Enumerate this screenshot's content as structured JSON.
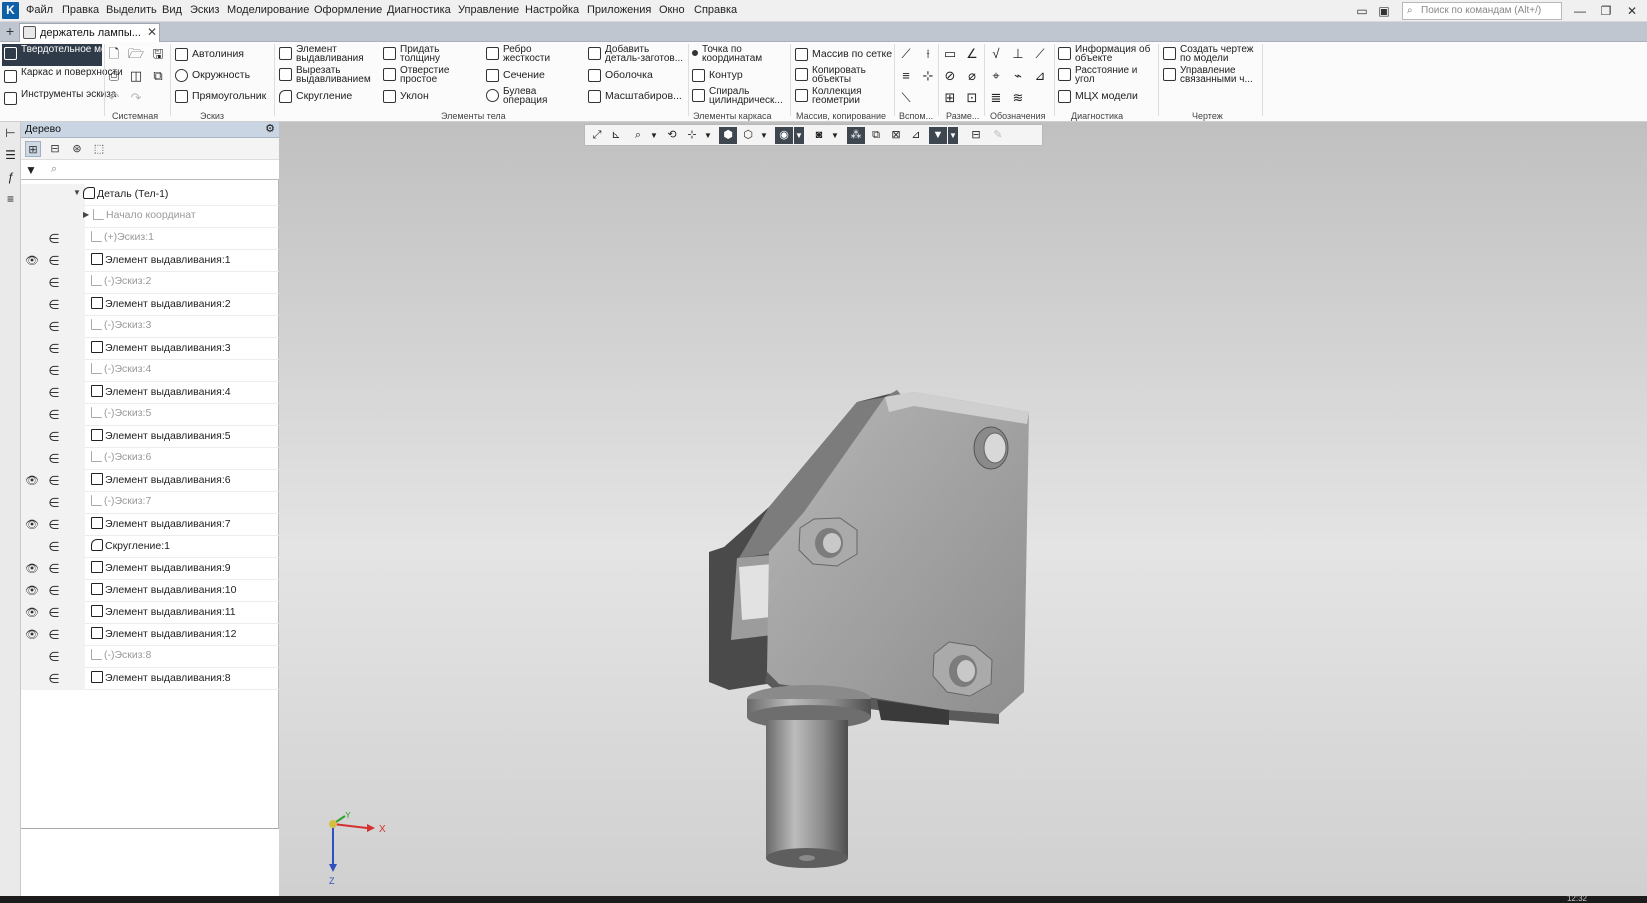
{
  "menubar": {
    "items": [
      "Файл",
      "Правка",
      "Выделить",
      "Вид",
      "Эскиз",
      "Моделирование",
      "Оформление",
      "Диагностика",
      "Управление",
      "Настройка",
      "Приложения",
      "Окно",
      "Справка"
    ],
    "search_placeholder": "Поиск по командам (Alt+/)"
  },
  "tabs": {
    "document": "держатель лампы..."
  },
  "ribbon": {
    "modes": [
      "Твердотельное моделирование",
      "Каркас и поверхности",
      "Инструменты эскиза"
    ],
    "sketch": [
      "Автолиния",
      "Окружность",
      "Прямоугольник"
    ],
    "body1": [
      "Элемент выдавливания",
      "Вырезать выдавливанием",
      "Скругление"
    ],
    "body2": [
      "Придать толщину",
      "Отверстие простое",
      "Уклон"
    ],
    "body3": [
      "Ребро жесткости",
      "Сечение",
      "Булева операция"
    ],
    "body4": [
      "Добавить деталь-заготов...",
      "Оболочка",
      "Масштабиров..."
    ],
    "frame": [
      "Точка по координатам",
      "Контур",
      "Спираль цилиндрическ..."
    ],
    "array": [
      "Массив по сетке",
      "Копировать объекты",
      "Коллекция геометрии"
    ],
    "diag": [
      "Информация об объекте",
      "Расстояние и угол",
      "МЦХ модели"
    ],
    "drawing": [
      "Создать чертеж по модели",
      "Управление связанными ч..."
    ],
    "group_titles": [
      "Системная",
      "Эскиз",
      "Элементы тела",
      "Элементы каркаса",
      "Массив, копирование",
      "Вспом...",
      "Разме...",
      "Обозначения",
      "Диагностика",
      "Чертеж"
    ]
  },
  "tree": {
    "title": "Дерево",
    "rows": [
      {
        "label": "Деталь (Тел-1)",
        "eye": false,
        "inc": false,
        "kind": "root"
      },
      {
        "label": "Начало координат",
        "eye": false,
        "inc": false,
        "kind": "origin"
      },
      {
        "label": "(+)Эскиз:1",
        "eye": false,
        "inc": true,
        "kind": "sketch"
      },
      {
        "label": "Элемент выдавливания:1",
        "eye": true,
        "inc": true,
        "kind": "feature"
      },
      {
        "label": "(-)Эскиз:2",
        "eye": false,
        "inc": true,
        "kind": "sketch"
      },
      {
        "label": "Элемент выдавливания:2",
        "eye": false,
        "inc": true,
        "kind": "feature"
      },
      {
        "label": "(-)Эскиз:3",
        "eye": false,
        "inc": true,
        "kind": "sketch"
      },
      {
        "label": "Элемент выдавливания:3",
        "eye": false,
        "inc": true,
        "kind": "feature"
      },
      {
        "label": "(-)Эскиз:4",
        "eye": false,
        "inc": true,
        "kind": "sketch"
      },
      {
        "label": "Элемент выдавливания:4",
        "eye": false,
        "inc": true,
        "kind": "feature"
      },
      {
        "label": "(-)Эскиз:5",
        "eye": false,
        "inc": true,
        "kind": "sketch"
      },
      {
        "label": "Элемент выдавливания:5",
        "eye": false,
        "inc": true,
        "kind": "feature"
      },
      {
        "label": "(-)Эскиз:6",
        "eye": false,
        "inc": true,
        "kind": "sketch"
      },
      {
        "label": "Элемент выдавливания:6",
        "eye": true,
        "inc": true,
        "kind": "feature"
      },
      {
        "label": "(-)Эскиз:7",
        "eye": false,
        "inc": true,
        "kind": "sketch"
      },
      {
        "label": "Элемент выдавливания:7",
        "eye": true,
        "inc": true,
        "kind": "feature"
      },
      {
        "label": "Скругление:1",
        "eye": false,
        "inc": true,
        "kind": "fillet"
      },
      {
        "label": "Элемент выдавливания:9",
        "eye": true,
        "inc": true,
        "kind": "feature"
      },
      {
        "label": "Элемент выдавливания:10",
        "eye": true,
        "inc": true,
        "kind": "feature"
      },
      {
        "label": "Элемент выдавливания:11",
        "eye": true,
        "inc": true,
        "kind": "feature"
      },
      {
        "label": "Элемент выдавливания:12",
        "eye": true,
        "inc": true,
        "kind": "feature"
      },
      {
        "label": "(-)Эскиз:8",
        "eye": false,
        "inc": true,
        "kind": "sketch"
      },
      {
        "label": "Элемент выдавливания:8",
        "eye": false,
        "inc": true,
        "kind": "feature"
      }
    ]
  },
  "axes": {
    "x": "X",
    "y": "Y",
    "z": "Z"
  },
  "clock": "12:32"
}
